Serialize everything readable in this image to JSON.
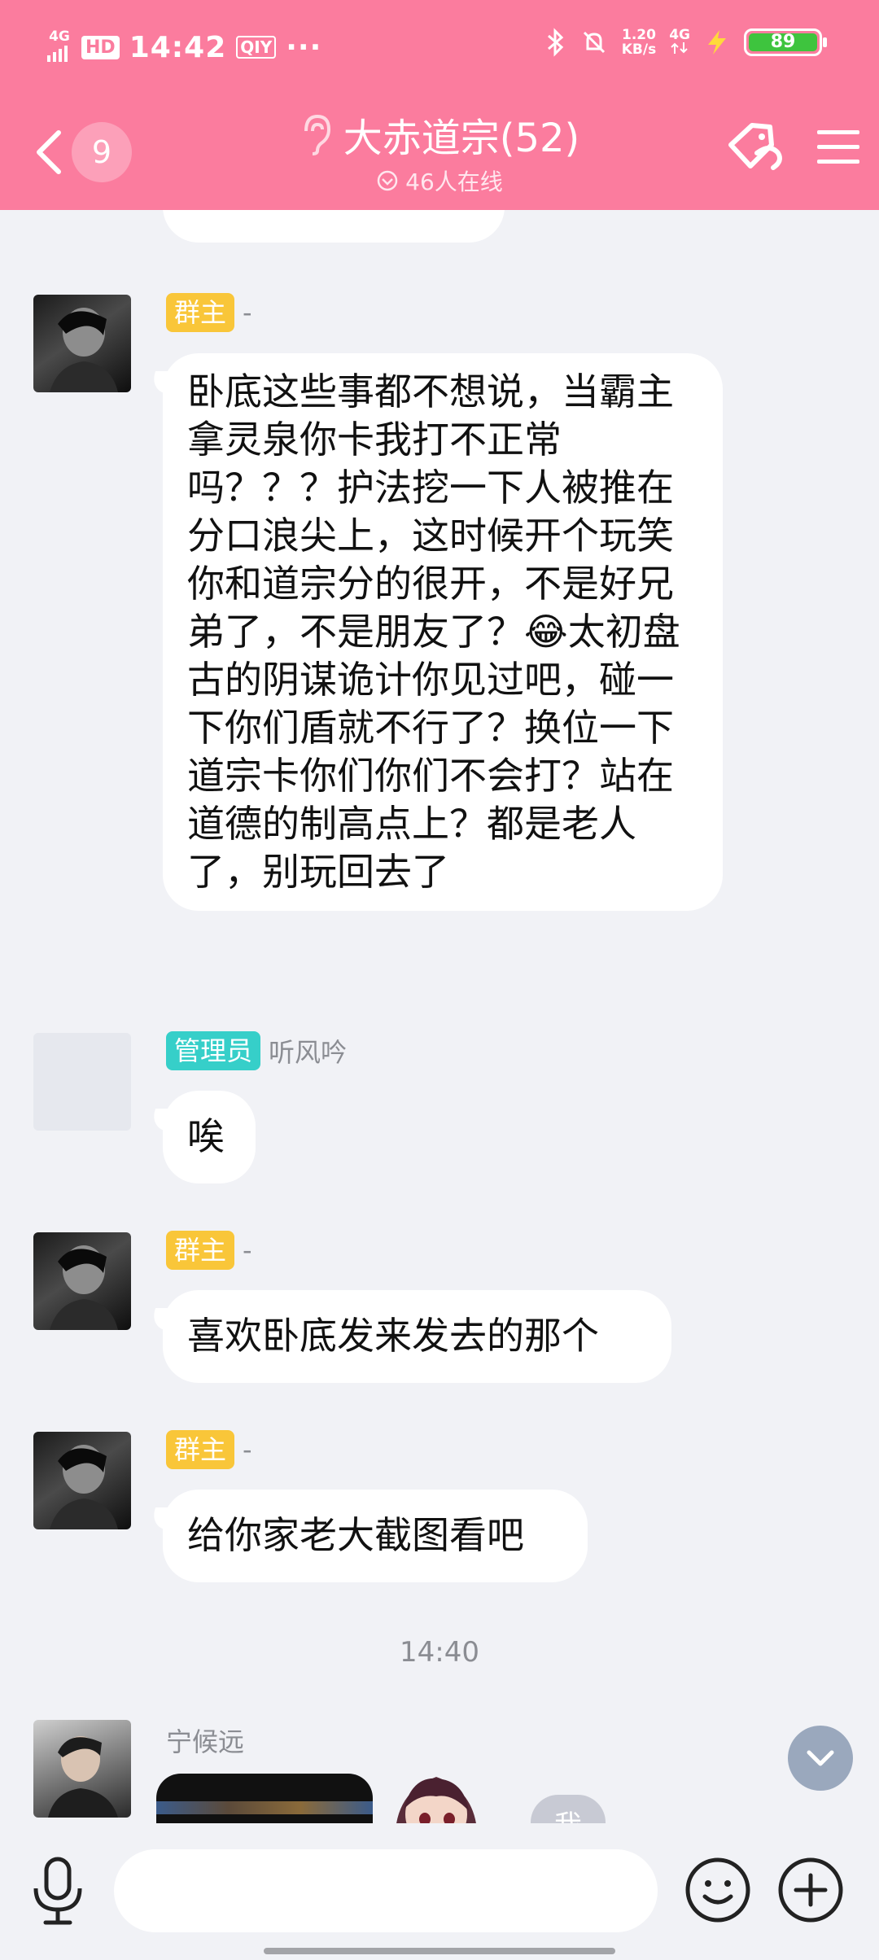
{
  "status_bar": {
    "network_left": "4G",
    "hd_label": "HD",
    "time": "14:42",
    "app_badge": "QIY",
    "more_dots": "···",
    "speed_value": "1.20",
    "speed_unit": "KB/s",
    "network_right": "4G",
    "battery": "89"
  },
  "header": {
    "unread_count": "9",
    "title": "大赤道宗(52)",
    "online_text": "46人在线"
  },
  "messages": [
    {
      "role_tag": "群主",
      "sender": "-",
      "text": "卧底这些事都不想说，当霸主拿灵泉你卡我打不正常吗？？？护法挖一下人被推在分口浪尖上，这时候开个玩笑你和道宗分的很开，不是好兄弟了，不是朋友了？😂太初盘古的阴谋诡计你见过吧，碰一下你们盾就不行了？换位一下道宗卡你们你们不会打？站在道德的制高点上？都是老人了，别玩回去了"
    },
    {
      "role_tag": "管理员",
      "sender": "听风吟",
      "text": "唉"
    },
    {
      "role_tag": "群主",
      "sender": "-",
      "text": "喜欢卧底发来发去的那个"
    },
    {
      "role_tag": "群主",
      "sender": "-",
      "text": "给你家老大截图看吧"
    }
  ],
  "timestamp": "14:40",
  "last_sender": "宁候远",
  "me_label": "我",
  "input": {
    "placeholder": ""
  }
}
